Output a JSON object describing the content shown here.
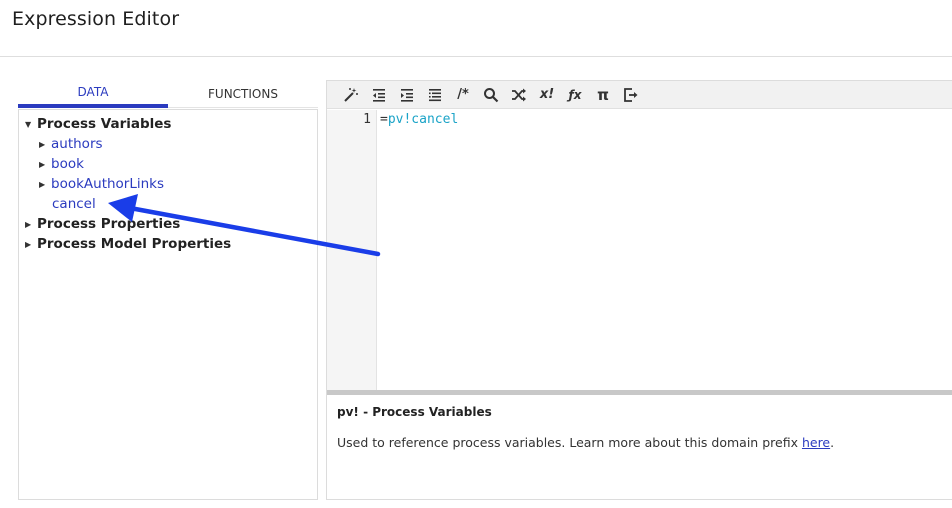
{
  "header": {
    "title": "Expression Editor"
  },
  "tabs": [
    {
      "label": "DATA",
      "active": true
    },
    {
      "label": "FUNCTIONS",
      "active": false
    }
  ],
  "tree": {
    "process_variables": "Process Variables",
    "authors": "authors",
    "book": "book",
    "book_author_links": "bookAuthorLinks",
    "cancel": "cancel",
    "process_properties": "Process Properties",
    "process_model_properties": "Process Model Properties"
  },
  "toolbar": {
    "comment": "/*",
    "factorial": "x!",
    "function": "ƒx",
    "pi": "π"
  },
  "editor": {
    "line_number": "1",
    "code_prefix": "=",
    "code_token": "pv!cancel"
  },
  "help": {
    "title": "pv! - Process Variables",
    "text": "Used to reference process variables. Learn more about this domain prefix ",
    "link": "here",
    "suffix": "."
  },
  "colors": {
    "accent": "#2b3bbf",
    "token": "#1aa3c7",
    "annotation_arrow": "#1a3de8"
  }
}
